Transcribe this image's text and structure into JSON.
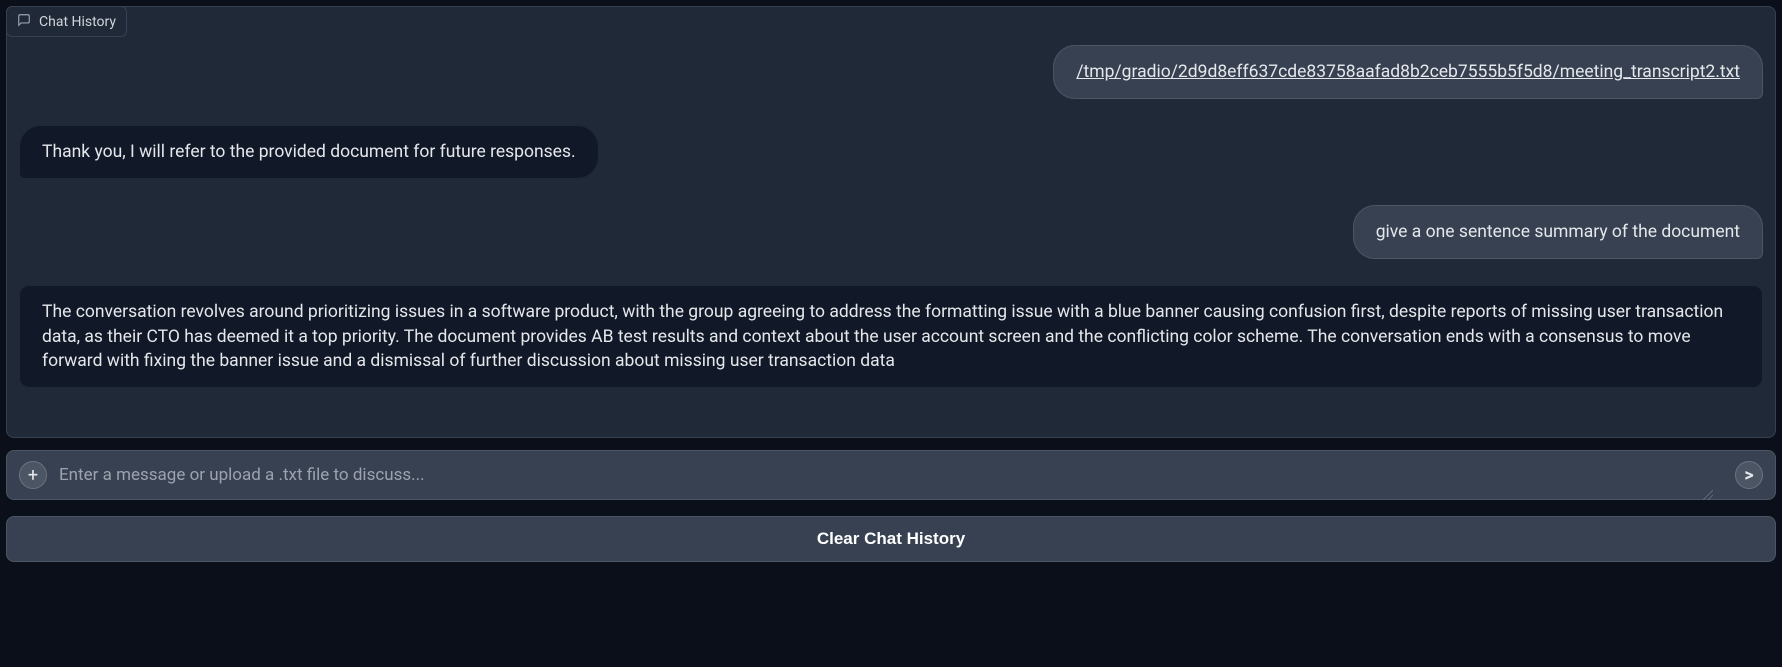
{
  "header": {
    "tab_label": "Chat History"
  },
  "messages": [
    {
      "role": "user",
      "type": "file",
      "text": "/tmp/gradio/2d9d8eff637cde83758aafad8b2ceb7555b5f5d8/meeting_transcript2.txt"
    },
    {
      "role": "bot",
      "type": "text",
      "text": "Thank you, I will refer to the provided document for future responses."
    },
    {
      "role": "user",
      "type": "text",
      "text": "give a one sentence summary of the document"
    },
    {
      "role": "bot",
      "type": "wide",
      "text": "The conversation revolves around prioritizing issues in a software product, with the group agreeing to address the formatting issue with a blue banner causing confusion first, despite reports of missing user transaction data, as their CTO has deemed it a top priority. The document provides AB test results and context about the user account screen and the conflicting color scheme. The conversation ends with a consensus to move forward with fixing the banner issue and a dismissal of further discussion about missing user transaction data"
    }
  ],
  "input": {
    "placeholder": "Enter a message or upload a .txt file to discuss...",
    "value": ""
  },
  "buttons": {
    "add": "+",
    "send": ">",
    "clear": "Clear Chat History"
  }
}
